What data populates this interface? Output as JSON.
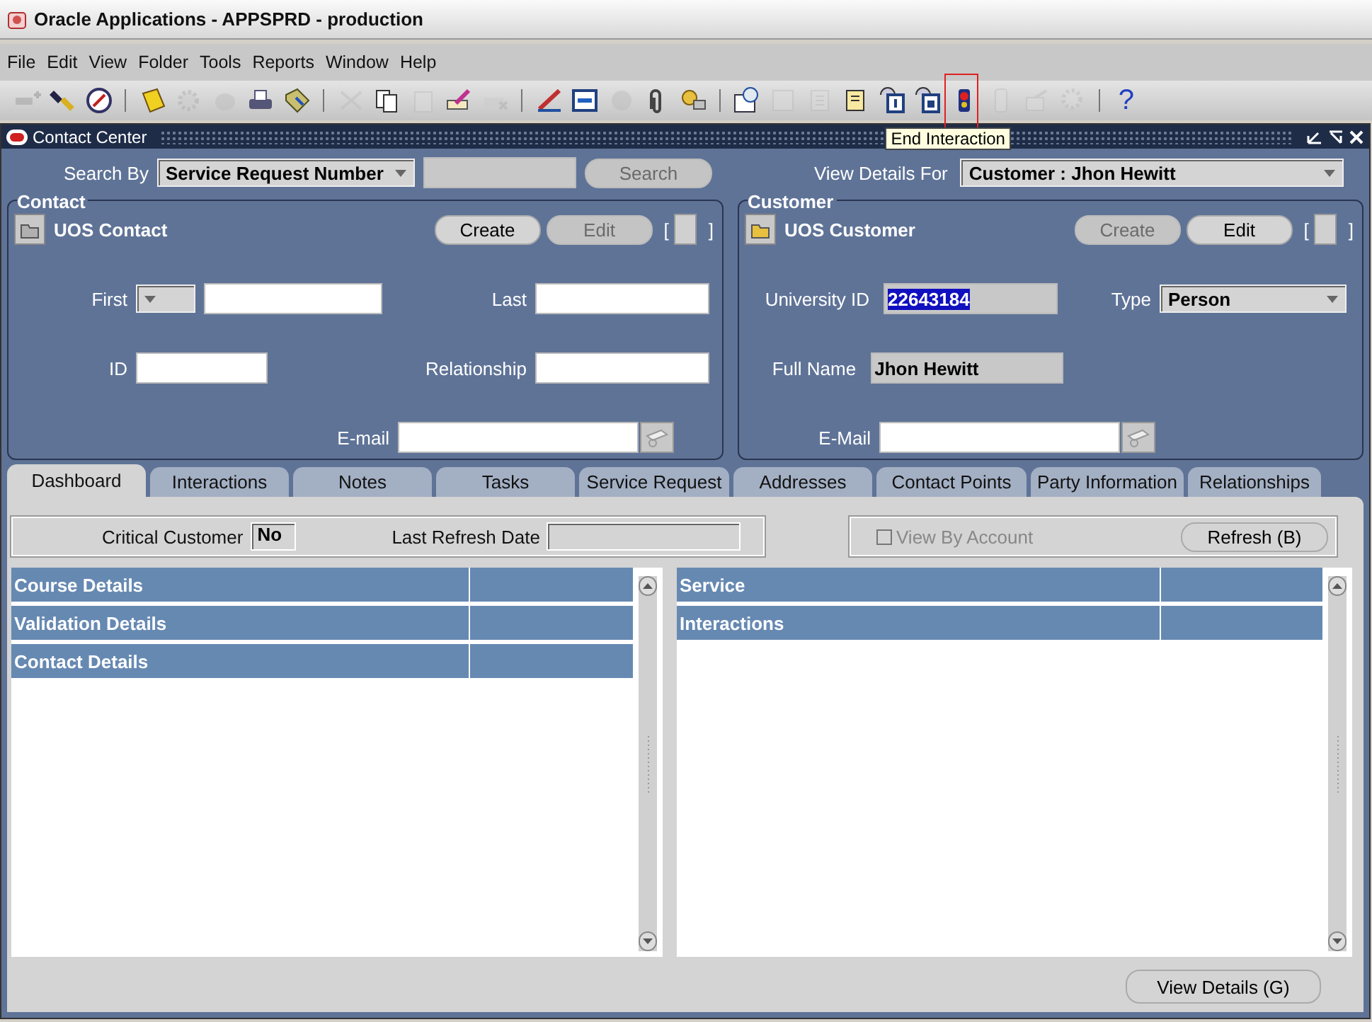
{
  "window": {
    "title": "Oracle Applications - APPSPRD - production"
  },
  "menu": [
    "File",
    "Edit",
    "View",
    "Folder",
    "Tools",
    "Reports",
    "Window",
    "Help"
  ],
  "toolbar": [
    {
      "kind": "icon",
      "disabled": true
    },
    {
      "kind": "icon",
      "disabled": false
    },
    {
      "kind": "icon",
      "disabled": false
    },
    {
      "kind": "separator"
    },
    {
      "kind": "icon",
      "disabled": false
    },
    {
      "kind": "icon",
      "disabled": true
    },
    {
      "kind": "icon",
      "disabled": true
    },
    {
      "kind": "icon",
      "disabled": false
    },
    {
      "kind": "icon",
      "disabled": false
    },
    {
      "kind": "separator"
    },
    {
      "kind": "icon",
      "disabled": true
    },
    {
      "kind": "icon",
      "disabled": false
    },
    {
      "kind": "icon",
      "disabled": true
    },
    {
      "kind": "icon",
      "disabled": false
    },
    {
      "kind": "icon",
      "disabled": true
    },
    {
      "kind": "separator"
    },
    {
      "kind": "icon",
      "disabled": false
    },
    {
      "kind": "icon",
      "disabled": false
    },
    {
      "kind": "icon",
      "disabled": true
    },
    {
      "kind": "icon",
      "disabled": false
    },
    {
      "kind": "icon",
      "disabled": false
    },
    {
      "kind": "separator"
    },
    {
      "kind": "icon",
      "disabled": false
    },
    {
      "kind": "icon",
      "disabled": true
    },
    {
      "kind": "icon",
      "disabled": true
    },
    {
      "kind": "icon",
      "disabled": false
    },
    {
      "kind": "icon",
      "disabled": false
    },
    {
      "kind": "icon",
      "disabled": false
    },
    {
      "kind": "icon",
      "disabled": false,
      "highlighted": true,
      "tooltip": "End Interaction"
    },
    {
      "kind": "icon",
      "disabled": true
    },
    {
      "kind": "icon",
      "disabled": true
    },
    {
      "kind": "icon",
      "disabled": true
    },
    {
      "kind": "separator"
    },
    {
      "kind": "text",
      "label": "?",
      "disabled": false
    }
  ],
  "form": {
    "title": "Contact Center",
    "search": {
      "label": "Search By",
      "option": "Service Request Number",
      "button": "Search",
      "button_disabled": true
    },
    "view_details_for": {
      "label": "View Details For",
      "value": "Customer : Jhon Hewitt"
    },
    "panels": [
      {
        "legend": "Contact",
        "heading": "UOS Contact",
        "indicator": {
          "open": "[",
          "close": "]"
        },
        "buttons": [
          {
            "label": "Create",
            "disabled": false
          },
          {
            "label": "Edit",
            "disabled": true
          }
        ],
        "rows": [
          [
            {
              "label": "First",
              "kind": "combo"
            },
            {
              "label": "Last",
              "kind": "text"
            }
          ],
          [
            {
              "label": "ID",
              "kind": "text"
            },
            {
              "label": "Relationship",
              "kind": "text"
            }
          ],
          [
            {
              "label": "E-mail",
              "kind": "email"
            }
          ]
        ]
      },
      {
        "legend": "Customer",
        "heading": "UOS Customer",
        "indicator": {
          "open": "[",
          "close": "]"
        },
        "buttons": [
          {
            "label": "Create",
            "disabled": true
          },
          {
            "label": "Edit",
            "disabled": false
          }
        ],
        "rows": [
          [
            {
              "label": "University ID",
              "kind": "readonly",
              "value": "22643184",
              "selected": true
            },
            {
              "label": "Type",
              "kind": "select",
              "value": "Person"
            }
          ],
          [
            {
              "label": "Full Name",
              "kind": "readonly",
              "value": "Jhon Hewitt",
              "selected": false
            }
          ],
          [
            {
              "label": "E-Mail",
              "kind": "email"
            }
          ]
        ]
      }
    ],
    "tabs": [
      {
        "label": "Dashboard",
        "selected": true
      },
      {
        "label": "Interactions",
        "selected": false
      },
      {
        "label": "Notes",
        "selected": false
      },
      {
        "label": "Tasks",
        "selected": false
      },
      {
        "label": "Service Request",
        "selected": false
      },
      {
        "label": "Addresses",
        "selected": false
      },
      {
        "label": "Contact Points",
        "selected": false
      },
      {
        "label": "Party Information",
        "selected": false
      },
      {
        "label": "Relationships",
        "selected": false
      }
    ],
    "dashboard": {
      "critical_customer": {
        "label": "Critical Customer",
        "value": "No"
      },
      "last_refresh": {
        "label": "Last Refresh Date"
      },
      "view_by_account": {
        "label": "View By Account",
        "checked": false,
        "disabled": true
      },
      "refresh_button": "Refresh  (B)",
      "lists": [
        {
          "rows": [
            "Course Details",
            "Validation Details",
            "Contact Details"
          ]
        },
        {
          "rows": [
            "Service",
            "Interactions"
          ]
        }
      ],
      "view_details_button": "View Details  (G)"
    }
  }
}
